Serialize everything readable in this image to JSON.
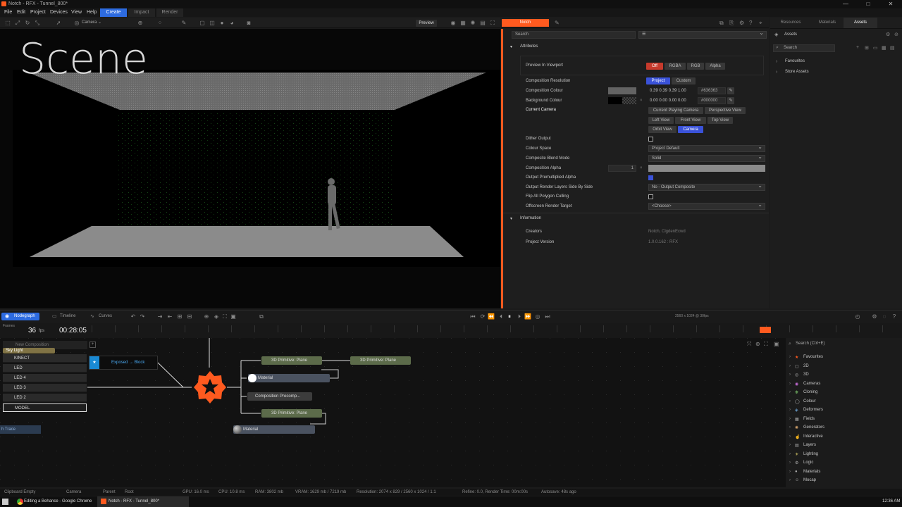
{
  "app": {
    "title": "Notch - RFX - Tunnel_800*"
  },
  "window_controls": {
    "minimize": "—",
    "maximize": "□",
    "close": "✕"
  },
  "menu": [
    "File",
    "Edit",
    "Project",
    "Devices",
    "View",
    "Help"
  ],
  "modes": {
    "create": "Create",
    "impact": "Impact",
    "render": "Render"
  },
  "viewport": {
    "camera_label": "Camera",
    "preview_label": "Preview",
    "scene_title": "Scene"
  },
  "props": {
    "node_tab": "Notch",
    "search_placeholder": "Search",
    "attributes_label": "Attributes",
    "preview_in_viewport": {
      "label": "Preview In Viewport",
      "options": [
        "Off",
        "RGBA",
        "RGB",
        "Alpha"
      ]
    },
    "composition_resolution": {
      "label": "Composition Resolution",
      "options": [
        "Project",
        "Custom"
      ]
    },
    "composition_colour": {
      "label": "Composition Colour",
      "value": "0.39 0.39 0.39 1.00",
      "hex": "#636363"
    },
    "background_colour": {
      "label": "Background Colour",
      "value": "0.00 0.00 0.00 0.00",
      "hex": "#000000"
    },
    "current_camera": {
      "label": "Current Camera",
      "options": [
        "Current Playing Camera",
        "Perspective View",
        "Left View",
        "Front View",
        "Top View",
        "Orbit View",
        "Camera"
      ]
    },
    "dither_output": "Dither Output",
    "colour_space": {
      "label": "Colour Space",
      "value": "Project Default"
    },
    "composite_blend_mode": {
      "label": "Composite Blend Mode",
      "value": "Solid"
    },
    "composition_alpha": {
      "label": "Composition Alpha",
      "value": "1"
    },
    "output_premultiplied_alpha": "Output Premultiplied Alpha",
    "output_render_layers": {
      "label": "Output Render Layers Side By Side",
      "value": "No - Output Composite"
    },
    "flip_all_polygon_culling": "Flip All Polygon Culling",
    "offscreen_render_target": {
      "label": "Offscreen Render Target",
      "value": "<Choose>"
    },
    "information_label": "Information",
    "creators": {
      "label": "Creators",
      "value": "Notch, ClgdenEcwd"
    },
    "project_version": {
      "label": "Project Version",
      "value": "1.0.0.162 : RFX"
    }
  },
  "right_panel": {
    "tabs": [
      "Resources",
      "Materials",
      "Assets"
    ],
    "assets_label": "Assets",
    "search_placeholder": "Search",
    "items": [
      "Favourites",
      "Store Assets"
    ]
  },
  "bottom": {
    "tabs": [
      "Nodegraph",
      "Timeline",
      "Curves"
    ],
    "resolution_info": "2560 x 1024 @ 30fps",
    "frames_label": "Frames",
    "fps_value": "36",
    "fps_unit": "fps",
    "timecode": "00:28:05"
  },
  "layers": {
    "header": "New Composition",
    "items": [
      "Sky Light",
      "KINECT",
      "LED",
      "LED 4",
      "LED 3",
      "LED 2",
      "MODEL"
    ],
    "trace_label": "h Trace"
  },
  "nodes": {
    "exposed": "Exposed → Block",
    "plane1": "3D Primitive: Plane",
    "plane2": "3D Primitive: Plane",
    "plane3": "3D Primitive: Plane",
    "material1": "Material",
    "material2": "Material",
    "precomp": "Composition Precomp..."
  },
  "library": {
    "search_placeholder": "Search (Ctrl+E)",
    "items": [
      "Favourites",
      "2D",
      "3D",
      "Cameras",
      "Cloning",
      "Colour",
      "Deformers",
      "Fields",
      "Generators",
      "Interactive",
      "Layers",
      "Lighting",
      "Logic",
      "Materials",
      "Mocap"
    ]
  },
  "status": {
    "clipboard": "Clipboard Empty",
    "camera": "Camera",
    "parent": "Parent",
    "root": "Root",
    "gpu": "GPU: 16.0 ms",
    "cpu": "CPU: 10.8 ms",
    "ram": "RAM: 3802 mb",
    "vram": "VRAM: 1629 mb / 7219 mb",
    "resolution": "Resolution: 2074 x 829 / 2560 x 1024 / 1:1",
    "refine": "Refine: 0.0, Render Time: 00m:00s",
    "autosave": "Autosave: 48s ago"
  },
  "taskbar": {
    "chrome_item": "Editing a Behance - Google Chrome",
    "notch_item": "Notch - RFX - Tunnel_800*",
    "clock": "12:36 AM"
  },
  "colors": {
    "accent_orange": "#ff5a1f",
    "accent_blue": "#2d6be0",
    "on_blue": "#3a52d9",
    "off_red": "#c73a2c"
  }
}
